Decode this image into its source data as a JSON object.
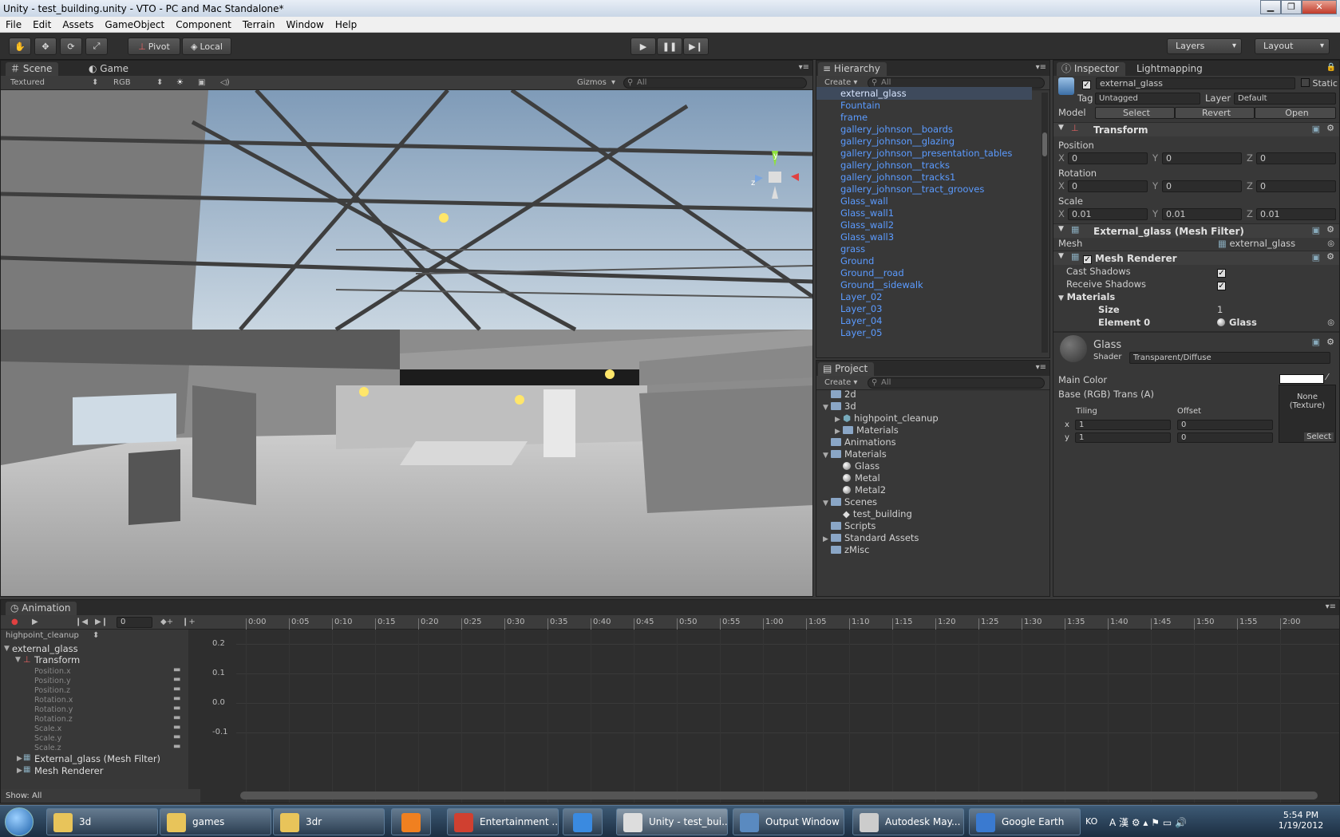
{
  "window": {
    "title": "Unity - test_building.unity - VTO - PC and Mac Standalone*"
  },
  "menu": [
    "File",
    "Edit",
    "Assets",
    "GameObject",
    "Component",
    "Terrain",
    "Window",
    "Help"
  ],
  "toolbar": {
    "pivot": "Pivot",
    "local": "Local",
    "layers": "Layers",
    "layout": "Layout"
  },
  "scene": {
    "tab_scene": "Scene",
    "tab_game": "Game",
    "render_mode": "Textured",
    "color_mode": "RGB",
    "gizmos": "Gizmos",
    "search_placeholder": "All",
    "gizmo_y": "y",
    "gizmo_z": "z"
  },
  "hierarchy": {
    "tab": "Hierarchy",
    "create": "Create",
    "search_placeholder": "All",
    "items": [
      "external_glass",
      "Fountain",
      "frame",
      "gallery_johnson__boards",
      "gallery_johnson__glazing",
      "gallery_johnson__presentation_tables",
      "gallery_johnson__tracks",
      "gallery_johnson__tracks1",
      "gallery_johnson__tract_grooves",
      "Glass_wall",
      "Glass_wall1",
      "Glass_wall2",
      "Glass_wall3",
      "grass",
      "Ground",
      "Ground__road",
      "Ground__sidewalk",
      "Layer_02",
      "Layer_03",
      "Layer_04",
      "Layer_05"
    ]
  },
  "project": {
    "tab": "Project",
    "create": "Create",
    "search_placeholder": "All",
    "items": [
      {
        "label": "2d",
        "indent": 0,
        "type": "folder",
        "arrow": ""
      },
      {
        "label": "3d",
        "indent": 0,
        "type": "folder",
        "arrow": "▼"
      },
      {
        "label": "highpoint_cleanup",
        "indent": 1,
        "type": "prefab",
        "arrow": "▶"
      },
      {
        "label": "Materials",
        "indent": 1,
        "type": "folder",
        "arrow": "▶"
      },
      {
        "label": "Animations",
        "indent": 0,
        "type": "folder",
        "arrow": ""
      },
      {
        "label": "Materials",
        "indent": 0,
        "type": "folder",
        "arrow": "▼"
      },
      {
        "label": "Glass",
        "indent": 1,
        "type": "material",
        "arrow": ""
      },
      {
        "label": "Metal",
        "indent": 1,
        "type": "material",
        "arrow": ""
      },
      {
        "label": "Metal2",
        "indent": 1,
        "type": "material",
        "arrow": ""
      },
      {
        "label": "Scenes",
        "indent": 0,
        "type": "folder",
        "arrow": "▼"
      },
      {
        "label": "test_building",
        "indent": 1,
        "type": "scene",
        "arrow": ""
      },
      {
        "label": "Scripts",
        "indent": 0,
        "type": "folder",
        "arrow": ""
      },
      {
        "label": "Standard Assets",
        "indent": 0,
        "type": "folder",
        "arrow": "▶"
      },
      {
        "label": "zMisc",
        "indent": 0,
        "type": "folder",
        "arrow": ""
      }
    ]
  },
  "inspector": {
    "tab": "Inspector",
    "tab2": "Lightmapping",
    "object_name": "external_glass",
    "static": "Static",
    "tag_label": "Tag",
    "tag_value": "Untagged",
    "layer_label": "Layer",
    "layer_value": "Default",
    "model_label": "Model",
    "select": "Select",
    "revert": "Revert",
    "open": "Open",
    "transform": {
      "title": "Transform",
      "position": "Position",
      "rotation": "Rotation",
      "scale": "Scale",
      "x": "X",
      "y": "Y",
      "z": "Z",
      "pos": [
        "0",
        "0",
        "0"
      ],
      "rot": [
        "0",
        "0",
        "0"
      ],
      "scl": [
        "0.01",
        "0.01",
        "0.01"
      ]
    },
    "mesh_filter": {
      "title": "External_glass (Mesh Filter)",
      "mesh_label": "Mesh",
      "mesh_value": "external_glass"
    },
    "mesh_renderer": {
      "title": "Mesh Renderer",
      "cast_shadows": "Cast Shadows",
      "receive_shadows": "Receive Shadows",
      "materials": "Materials",
      "size_label": "Size",
      "size_value": "1",
      "element_label": "Element 0",
      "element_value": "Glass"
    },
    "material": {
      "name": "Glass",
      "shader_label": "Shader",
      "shader_value": "Transparent/Diffuse",
      "main_color": "Main Color",
      "base": "Base (RGB) Trans (A)",
      "none_texture": "None\n(Texture)",
      "tiling": "Tiling",
      "offset": "Offset",
      "x": "x",
      "y": "y",
      "tile_x": "1",
      "tile_y": "1",
      "off_x": "0",
      "off_y": "0",
      "select": "Select"
    }
  },
  "animation": {
    "tab": "Animation",
    "frame": "0",
    "clip": "highpoint_cleanup",
    "object": "external_glass",
    "transform": "Transform",
    "props": [
      "Position.x",
      "Position.y",
      "Position.z",
      "Rotation.x",
      "Rotation.y",
      "Rotation.z",
      "Scale.x",
      "Scale.y",
      "Scale.z"
    ],
    "mesh_filter": "External_glass (Mesh Filter)",
    "mesh_renderer": "Mesh Renderer",
    "show": "Show: All",
    "timeline": [
      "0:00",
      "0:05",
      "0:10",
      "0:15",
      "0:20",
      "0:25",
      "0:30",
      "0:35",
      "0:40",
      "0:45",
      "0:50",
      "0:55",
      "1:00",
      "1:05",
      "1:10",
      "1:15",
      "1:20",
      "1:25",
      "1:30",
      "1:35",
      "1:40",
      "1:45",
      "1:50",
      "1:55",
      "2:00"
    ],
    "yvals": [
      "0.2",
      "0.1",
      "0.0",
      "-0.1"
    ]
  },
  "taskbar": {
    "items": [
      "3d",
      "games",
      "3dr",
      "",
      "Entertainment ...",
      "",
      "Unity - test_bui...",
      "Output Window",
      "Autodesk May...",
      "Google Earth"
    ],
    "lang": "KO",
    "time": "5:54 PM",
    "date": "1/19/2012"
  }
}
